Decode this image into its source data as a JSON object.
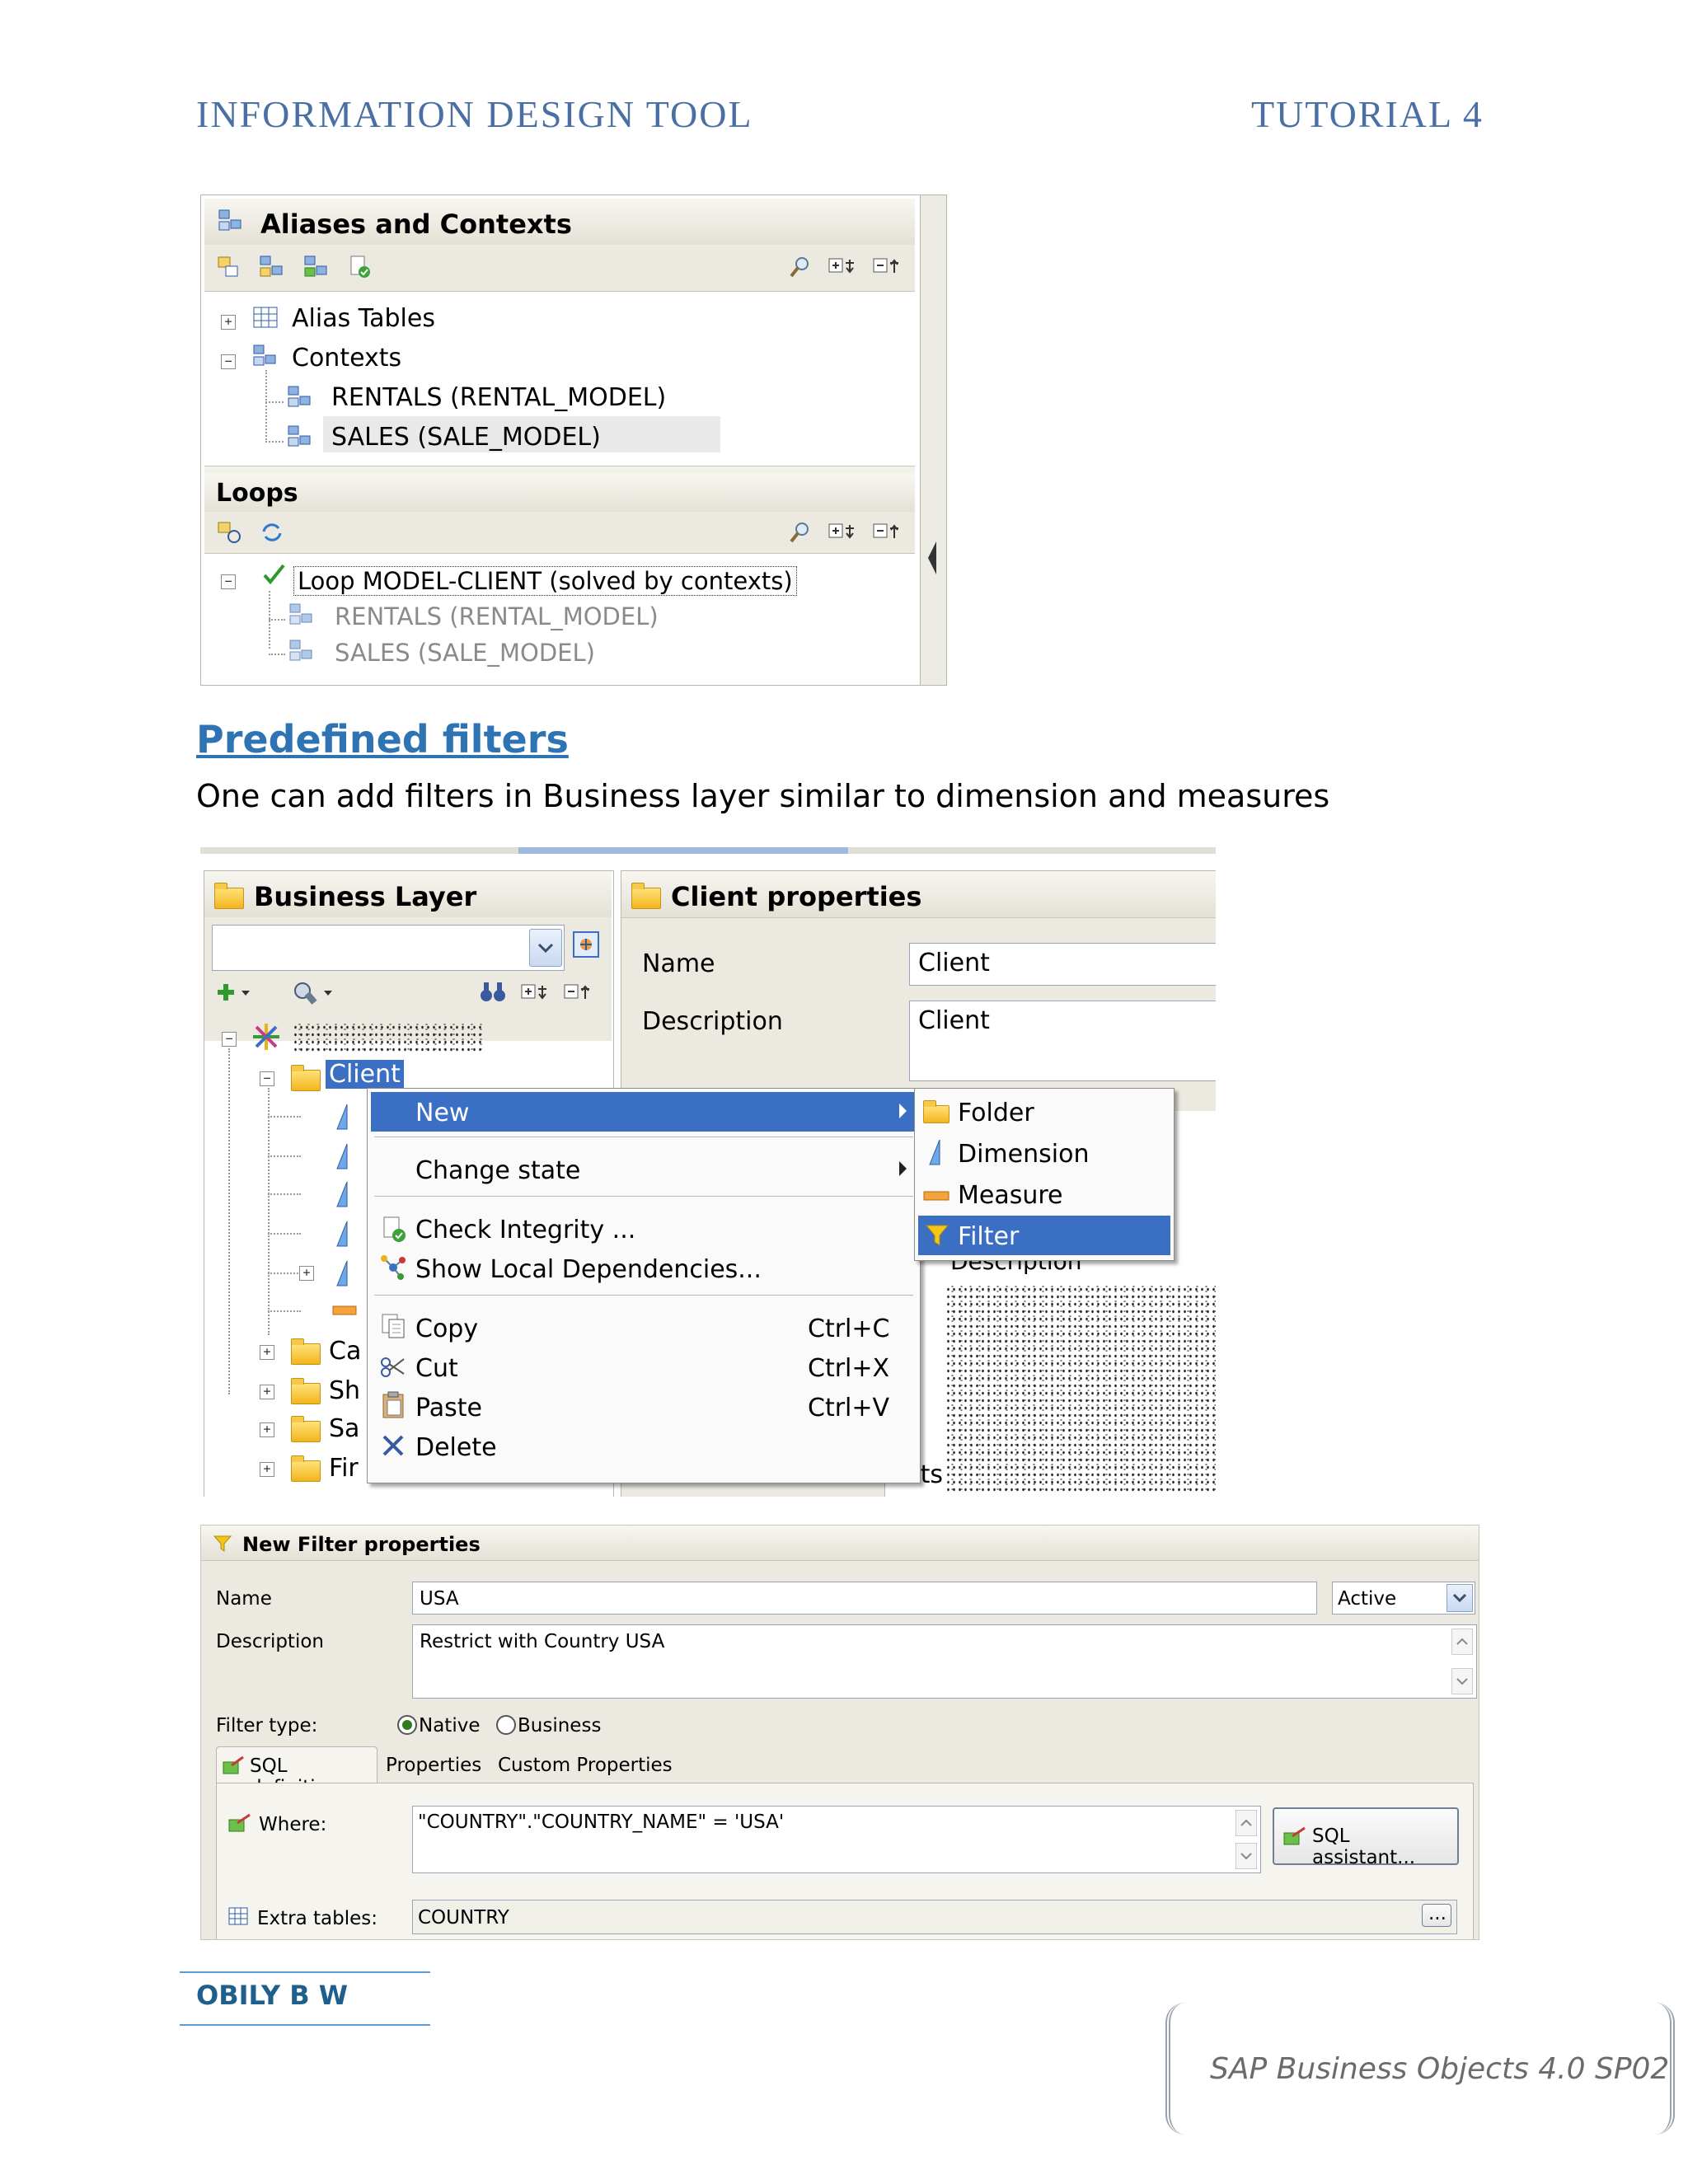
{
  "header": {
    "left": "INFORMATION DESIGN TOOL",
    "right": "TUTORIAL 4"
  },
  "aliases_panel": {
    "title": "Aliases and Contexts",
    "tree": {
      "alias_tables": "Alias Tables",
      "contexts": "Contexts",
      "context_items": [
        "RENTALS (RENTAL_MODEL)",
        "SALES (SALE_MODEL)"
      ]
    },
    "loops_title": "Loops",
    "loop": {
      "label": "Loop MODEL-CLIENT (solved by contexts)",
      "items": [
        "RENTALS (RENTAL_MODEL)",
        "SALES (SALE_MODEL)"
      ]
    }
  },
  "section": {
    "heading": "Predefined filters",
    "body": "One can add filters in Business layer similar to dimension and measures"
  },
  "business_layer": {
    "title": "Business Layer",
    "tree": {
      "client": "Client",
      "folders": [
        "Ca",
        "Sh",
        "Sa",
        "Fir"
      ]
    }
  },
  "client_properties": {
    "title": "Client properties",
    "name_label": "Name",
    "name_value": "Client",
    "description_label": "Description",
    "description_value": "Client",
    "partial_label": "Description",
    "partial_bottom": "Number of Clients"
  },
  "context_menu": {
    "new": "New",
    "change_state": "Change state",
    "check_integrity": "Check Integrity ...",
    "show_local_dependencies": "Show Local Dependencies...",
    "copy": "Copy",
    "copy_shortcut": "Ctrl+C",
    "cut": "Cut",
    "cut_shortcut": "Ctrl+X",
    "paste": "Paste",
    "paste_shortcut": "Ctrl+V",
    "delete": "Delete"
  },
  "submenu": {
    "folder": "Folder",
    "dimension": "Dimension",
    "measure": "Measure",
    "filter": "Filter"
  },
  "filter_properties": {
    "title": "New Filter properties",
    "name_label": "Name",
    "name_value": "USA",
    "state_value": "Active",
    "description_label": "Description",
    "description_value": "Restrict with Country USA",
    "filter_type_label": "Filter type:",
    "native_label": "Native",
    "business_label": "Business",
    "selected_type": "Native",
    "tabs": [
      "SQL definition",
      "Properties",
      "Custom Properties"
    ],
    "where_label": "Where:",
    "where_value": "\"COUNTRY\".\"COUNTRY_NAME\" = 'USA'",
    "sql_assistant_label": "SQL assistant...",
    "extra_tables_label": "Extra tables:",
    "extra_tables_value": "COUNTRY",
    "browse_label": "..."
  },
  "footer": {
    "author": "OBILY B W",
    "product": "SAP Business Objects 4.0 SP02"
  },
  "colors": {
    "header_blue": "#4a6fa5",
    "heading_blue": "#2e74b5",
    "selection_blue": "#3a6fc4",
    "footer_author": "#1f5f8b"
  }
}
